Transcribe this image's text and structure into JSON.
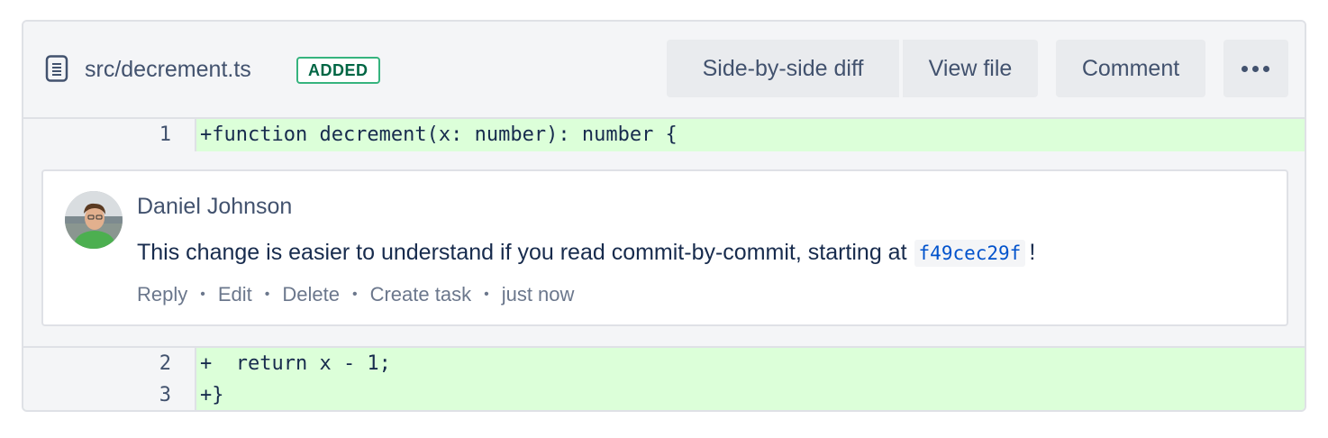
{
  "file": {
    "path": "src/decrement.ts",
    "status_badge": "ADDED",
    "icon": "file-lines-icon"
  },
  "toolbar": {
    "side_by_side_label": "Side-by-side diff",
    "view_file_label": "View file",
    "comment_label": "Comment",
    "more_icon": "more-horizontal-icon"
  },
  "diff": {
    "lines": [
      {
        "number": "1",
        "code": "+function decrement(x: number): number {"
      },
      {
        "number": "2",
        "code": "+  return x - 1;"
      },
      {
        "number": "3",
        "code": "+}"
      }
    ]
  },
  "comment": {
    "author": "Daniel Johnson",
    "text_before": "This change is easier to understand if you read commit-by-commit, starting at",
    "commit_ref": "f49cec29f",
    "text_after": "!",
    "actions": {
      "reply": "Reply",
      "edit": "Edit",
      "delete": "Delete",
      "create_task": "Create task",
      "timestamp": "just now",
      "separator": "•"
    }
  },
  "colors": {
    "added_bg": "#dcffd9",
    "badge_green": "#36b37e",
    "link_blue": "#0052cc",
    "panel_bg": "#f4f5f7"
  }
}
